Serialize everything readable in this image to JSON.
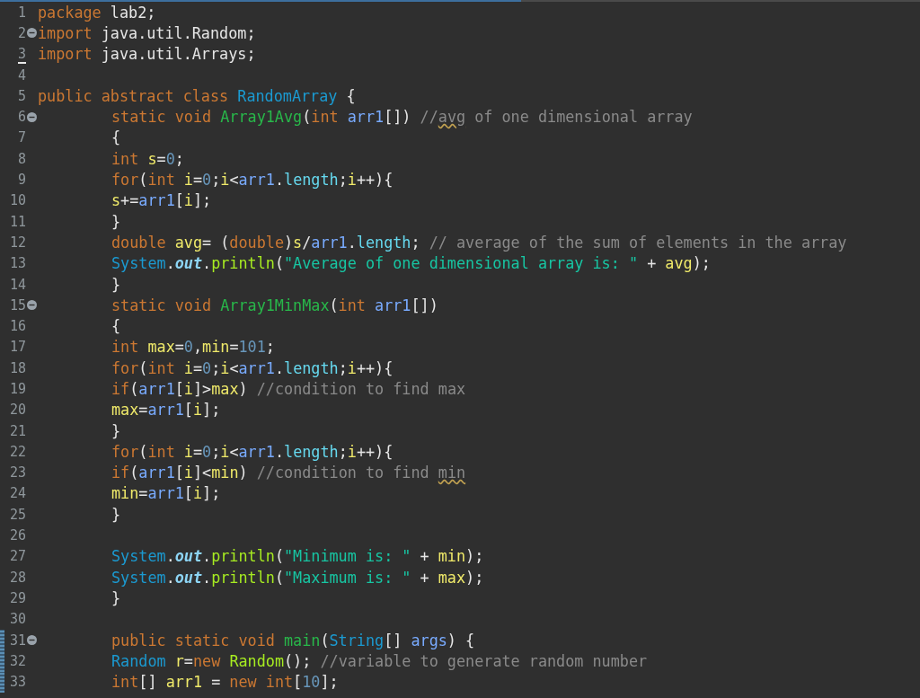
{
  "editor": {
    "lines": [
      {
        "number": "1",
        "foldable": false,
        "current": false,
        "changed": false,
        "tokens": [
          {
            "t": "package ",
            "kind": "keyword"
          },
          {
            "t": "lab2;",
            "kind": "plain"
          }
        ]
      },
      {
        "number": "2",
        "foldable": true,
        "current": false,
        "changed": false,
        "tokens": [
          {
            "t": "import ",
            "kind": "keyword"
          },
          {
            "t": "java.util.Random;",
            "kind": "plain"
          }
        ]
      },
      {
        "number": "3",
        "foldable": false,
        "current": true,
        "changed": false,
        "tokens": [
          {
            "t": "import ",
            "kind": "keyword"
          },
          {
            "t": "java.util.Arrays;",
            "kind": "plain"
          }
        ]
      },
      {
        "number": "4",
        "foldable": false,
        "current": false,
        "changed": false
      },
      {
        "number": "5",
        "foldable": false,
        "current": false,
        "changed": false,
        "tokens": [
          {
            "t": "public abstract class ",
            "kind": "keyword"
          },
          {
            "t": "RandomArray",
            "kind": "class"
          },
          {
            "t": " {",
            "kind": "plain"
          }
        ],
        "children": [
          {
            "number": "6",
            "foldable": true,
            "current": false,
            "changed": false,
            "tokens": [
              {
                "t": "static void ",
                "kind": "keyword"
              },
              {
                "t": "Array1Avg",
                "kind": "method"
              },
              {
                "t": "(",
                "kind": "plain"
              },
              {
                "t": "int ",
                "kind": "keyword"
              },
              {
                "t": "arr1",
                "kind": "param"
              },
              {
                "t": "[]) ",
                "kind": "plain"
              },
              {
                "t": "//",
                "kind": "comment"
              },
              {
                "t": "avg",
                "kind": "misspelled"
              },
              {
                "t": " of one dimensional array",
                "kind": "comment"
              }
            ]
          },
          {
            "number": "7",
            "foldable": false,
            "current": false,
            "changed": false,
            "tokens": [
              {
                "t": "{",
                "kind": "plain"
              }
            ]
          },
          {
            "number": "8",
            "foldable": false,
            "current": false,
            "changed": false,
            "tokens": [
              {
                "t": "int ",
                "kind": "keyword"
              },
              {
                "t": "s",
                "kind": "local"
              },
              {
                "t": "=",
                "kind": "plain"
              },
              {
                "t": "0",
                "kind": "number"
              },
              {
                "t": ";",
                "kind": "plain"
              }
            ]
          },
          {
            "number": "9",
            "foldable": false,
            "current": false,
            "changed": false,
            "tokens": [
              {
                "t": "for",
                "kind": "keyword"
              },
              {
                "t": "(",
                "kind": "plain"
              },
              {
                "t": "int ",
                "kind": "keyword"
              },
              {
                "t": "i",
                "kind": "local"
              },
              {
                "t": "=",
                "kind": "plain"
              },
              {
                "t": "0",
                "kind": "number"
              },
              {
                "t": ";",
                "kind": "plain"
              },
              {
                "t": "i",
                "kind": "local"
              },
              {
                "t": "<",
                "kind": "plain"
              },
              {
                "t": "arr1",
                "kind": "param"
              },
              {
                "t": ".",
                "kind": "plain"
              },
              {
                "t": "length",
                "kind": "field"
              },
              {
                "t": ";",
                "kind": "plain"
              },
              {
                "t": "i",
                "kind": "local"
              },
              {
                "t": "++){",
                "kind": "plain"
              }
            ]
          },
          {
            "number": "10",
            "foldable": false,
            "current": false,
            "changed": false,
            "tokens": [
              {
                "t": "s",
                "kind": "local"
              },
              {
                "t": "+=",
                "kind": "plain"
              },
              {
                "t": "arr1",
                "kind": "param"
              },
              {
                "t": "[",
                "kind": "plain"
              },
              {
                "t": "i",
                "kind": "local"
              },
              {
                "t": "];",
                "kind": "plain"
              }
            ]
          },
          {
            "number": "11",
            "foldable": false,
            "current": false,
            "changed": false,
            "tokens": [
              {
                "t": "}",
                "kind": "plain"
              }
            ]
          },
          {
            "number": "12",
            "foldable": false,
            "current": false,
            "changed": false,
            "tokens": [
              {
                "t": "double ",
                "kind": "keyword"
              },
              {
                "t": "avg",
                "kind": "local"
              },
              {
                "t": "= (",
                "kind": "plain"
              },
              {
                "t": "double",
                "kind": "keyword"
              },
              {
                "t": ")",
                "kind": "plain"
              },
              {
                "t": "s",
                "kind": "local"
              },
              {
                "t": "/",
                "kind": "plain"
              },
              {
                "t": "arr1",
                "kind": "param"
              },
              {
                "t": ".",
                "kind": "plain"
              },
              {
                "t": "length",
                "kind": "field"
              },
              {
                "t": "; ",
                "kind": "plain"
              },
              {
                "t": "// average of the sum of elements in the array",
                "kind": "comment"
              }
            ]
          },
          {
            "number": "13",
            "foldable": false,
            "current": false,
            "changed": false,
            "tokens": [
              {
                "t": "System",
                "kind": "class"
              },
              {
                "t": ".",
                "kind": "plain"
              },
              {
                "t": "out",
                "kind": "static"
              },
              {
                "t": ".",
                "kind": "plain"
              },
              {
                "t": "println",
                "kind": "call"
              },
              {
                "t": "(",
                "kind": "plain"
              },
              {
                "t": "\"Average of one dimensional array is: \"",
                "kind": "string"
              },
              {
                "t": " + ",
                "kind": "plain"
              },
              {
                "t": "avg",
                "kind": "local"
              },
              {
                "t": ");",
                "kind": "plain"
              }
            ]
          },
          {
            "number": "14",
            "foldable": false,
            "current": false,
            "changed": false,
            "tokens": [
              {
                "t": "}",
                "kind": "plain"
              }
            ]
          },
          {
            "number": "15",
            "foldable": true,
            "current": false,
            "changed": false,
            "tokens": [
              {
                "t": "static void ",
                "kind": "keyword"
              },
              {
                "t": "Array1MinMax",
                "kind": "method"
              },
              {
                "t": "(",
                "kind": "plain"
              },
              {
                "t": "int ",
                "kind": "keyword"
              },
              {
                "t": "arr1",
                "kind": "param"
              },
              {
                "t": "[])",
                "kind": "plain"
              }
            ]
          },
          {
            "number": "16",
            "foldable": false,
            "current": false,
            "changed": false,
            "tokens": [
              {
                "t": "{",
                "kind": "plain"
              }
            ]
          },
          {
            "number": "17",
            "foldable": false,
            "current": false,
            "changed": false,
            "tokens": [
              {
                "t": "int ",
                "kind": "keyword"
              },
              {
                "t": "max",
                "kind": "local"
              },
              {
                "t": "=",
                "kind": "plain"
              },
              {
                "t": "0",
                "kind": "number"
              },
              {
                "t": ",",
                "kind": "plain"
              },
              {
                "t": "min",
                "kind": "local"
              },
              {
                "t": "=",
                "kind": "plain"
              },
              {
                "t": "101",
                "kind": "number"
              },
              {
                "t": ";",
                "kind": "plain"
              }
            ]
          },
          {
            "number": "18",
            "foldable": false,
            "current": false,
            "changed": false,
            "tokens": [
              {
                "t": "for",
                "kind": "keyword"
              },
              {
                "t": "(",
                "kind": "plain"
              },
              {
                "t": "int ",
                "kind": "keyword"
              },
              {
                "t": "i",
                "kind": "local"
              },
              {
                "t": "=",
                "kind": "plain"
              },
              {
                "t": "0",
                "kind": "number"
              },
              {
                "t": ";",
                "kind": "plain"
              },
              {
                "t": "i",
                "kind": "local"
              },
              {
                "t": "<",
                "kind": "plain"
              },
              {
                "t": "arr1",
                "kind": "param"
              },
              {
                "t": ".",
                "kind": "plain"
              },
              {
                "t": "length",
                "kind": "field"
              },
              {
                "t": ";",
                "kind": "plain"
              },
              {
                "t": "i",
                "kind": "local"
              },
              {
                "t": "++){",
                "kind": "plain"
              }
            ]
          },
          {
            "number": "19",
            "foldable": false,
            "current": false,
            "changed": false,
            "tokens": [
              {
                "t": "if",
                "kind": "keyword"
              },
              {
                "t": "(",
                "kind": "plain"
              },
              {
                "t": "arr1",
                "kind": "param"
              },
              {
                "t": "[",
                "kind": "plain"
              },
              {
                "t": "i",
                "kind": "local"
              },
              {
                "t": "]>",
                "kind": "plain"
              },
              {
                "t": "max",
                "kind": "local"
              },
              {
                "t": ") ",
                "kind": "plain"
              },
              {
                "t": "//condition to find max",
                "kind": "comment"
              }
            ]
          },
          {
            "number": "20",
            "foldable": false,
            "current": false,
            "changed": false,
            "tokens": [
              {
                "t": "max",
                "kind": "local"
              },
              {
                "t": "=",
                "kind": "plain"
              },
              {
                "t": "arr1",
                "kind": "param"
              },
              {
                "t": "[",
                "kind": "plain"
              },
              {
                "t": "i",
                "kind": "local"
              },
              {
                "t": "];",
                "kind": "plain"
              }
            ]
          },
          {
            "number": "21",
            "foldable": false,
            "current": false,
            "changed": false,
            "tokens": [
              {
                "t": "}",
                "kind": "plain"
              }
            ]
          },
          {
            "number": "22",
            "foldable": false,
            "current": false,
            "changed": false,
            "tokens": [
              {
                "t": "for",
                "kind": "keyword"
              },
              {
                "t": "(",
                "kind": "plain"
              },
              {
                "t": "int ",
                "kind": "keyword"
              },
              {
                "t": "i",
                "kind": "local"
              },
              {
                "t": "=",
                "kind": "plain"
              },
              {
                "t": "0",
                "kind": "number"
              },
              {
                "t": ";",
                "kind": "plain"
              },
              {
                "t": "i",
                "kind": "local"
              },
              {
                "t": "<",
                "kind": "plain"
              },
              {
                "t": "arr1",
                "kind": "param"
              },
              {
                "t": ".",
                "kind": "plain"
              },
              {
                "t": "length",
                "kind": "field"
              },
              {
                "t": ";",
                "kind": "plain"
              },
              {
                "t": "i",
                "kind": "local"
              },
              {
                "t": "++){",
                "kind": "plain"
              }
            ]
          },
          {
            "number": "23",
            "foldable": false,
            "current": false,
            "changed": false,
            "tokens": [
              {
                "t": "if",
                "kind": "keyword"
              },
              {
                "t": "(",
                "kind": "plain"
              },
              {
                "t": "arr1",
                "kind": "param"
              },
              {
                "t": "[",
                "kind": "plain"
              },
              {
                "t": "i",
                "kind": "local"
              },
              {
                "t": "]<",
                "kind": "plain"
              },
              {
                "t": "min",
                "kind": "local"
              },
              {
                "t": ") ",
                "kind": "plain"
              },
              {
                "t": "//condition to find ",
                "kind": "comment"
              },
              {
                "t": "min",
                "kind": "misspelled"
              }
            ]
          },
          {
            "number": "24",
            "foldable": false,
            "current": false,
            "changed": false,
            "tokens": [
              {
                "t": "min",
                "kind": "local"
              },
              {
                "t": "=",
                "kind": "plain"
              },
              {
                "t": "arr1",
                "kind": "param"
              },
              {
                "t": "[",
                "kind": "plain"
              },
              {
                "t": "i",
                "kind": "local"
              },
              {
                "t": "];",
                "kind": "plain"
              }
            ]
          },
          {
            "number": "25",
            "foldable": false,
            "current": false,
            "changed": false,
            "tokens": [
              {
                "t": "}",
                "kind": "plain"
              }
            ]
          },
          {
            "number": "26",
            "foldable": false,
            "current": false,
            "changed": false
          },
          {
            "number": "27",
            "foldable": false,
            "current": false,
            "changed": false,
            "tokens": [
              {
                "t": "System",
                "kind": "class"
              },
              {
                "t": ".",
                "kind": "plain"
              },
              {
                "t": "out",
                "kind": "static"
              },
              {
                "t": ".",
                "kind": "plain"
              },
              {
                "t": "println",
                "kind": "call"
              },
              {
                "t": "(",
                "kind": "plain"
              },
              {
                "t": "\"Minimum is: \"",
                "kind": "string"
              },
              {
                "t": " + ",
                "kind": "plain"
              },
              {
                "t": "min",
                "kind": "local"
              },
              {
                "t": ");",
                "kind": "plain"
              }
            ]
          },
          {
            "number": "28",
            "foldable": false,
            "current": false,
            "changed": false,
            "tokens": [
              {
                "t": "System",
                "kind": "class"
              },
              {
                "t": ".",
                "kind": "plain"
              },
              {
                "t": "out",
                "kind": "static"
              },
              {
                "t": ".",
                "kind": "plain"
              },
              {
                "t": "println",
                "kind": "call"
              },
              {
                "t": "(",
                "kind": "plain"
              },
              {
                "t": "\"Maximum is: \"",
                "kind": "string"
              },
              {
                "t": " + ",
                "kind": "plain"
              },
              {
                "t": "max",
                "kind": "local"
              },
              {
                "t": ");",
                "kind": "plain"
              }
            ]
          },
          {
            "number": "29",
            "foldable": false,
            "current": false,
            "changed": false,
            "tokens": [
              {
                "t": "}",
                "kind": "plain"
              }
            ]
          },
          {
            "number": "30",
            "foldable": false,
            "current": false,
            "changed": false
          },
          {
            "number": "31",
            "foldable": true,
            "current": false,
            "changed": true,
            "tokens": [
              {
                "t": "public static void ",
                "kind": "keyword"
              },
              {
                "t": "main",
                "kind": "method"
              },
              {
                "t": "(",
                "kind": "plain"
              },
              {
                "t": "String",
                "kind": "class"
              },
              {
                "t": "[] ",
                "kind": "plain"
              },
              {
                "t": "args",
                "kind": "param"
              },
              {
                "t": ") {",
                "kind": "plain"
              }
            ]
          },
          {
            "number": "32",
            "foldable": false,
            "current": false,
            "changed": true,
            "tokens": [
              {
                "t": "Random ",
                "kind": "class"
              },
              {
                "t": "r",
                "kind": "local"
              },
              {
                "t": "=",
                "kind": "plain"
              },
              {
                "t": "new ",
                "kind": "keyword"
              },
              {
                "t": "Random",
                "kind": "call"
              },
              {
                "t": "(); ",
                "kind": "plain"
              },
              {
                "t": "//variable to generate random number",
                "kind": "comment"
              }
            ]
          },
          {
            "number": "33",
            "foldable": false,
            "current": false,
            "changed": true,
            "tokens": [
              {
                "t": "int",
                "kind": "keyword"
              },
              {
                "t": "[] ",
                "kind": "plain"
              },
              {
                "t": "arr1",
                "kind": "local"
              },
              {
                "t": " = ",
                "kind": "plain"
              },
              {
                "t": "new ",
                "kind": "keyword"
              },
              {
                "t": "int",
                "kind": "keyword"
              },
              {
                "t": "[",
                "kind": "plain"
              },
              {
                "t": "10",
                "kind": "number"
              },
              {
                "t": "];",
                "kind": "plain"
              }
            ]
          }
        ]
      }
    ]
  }
}
